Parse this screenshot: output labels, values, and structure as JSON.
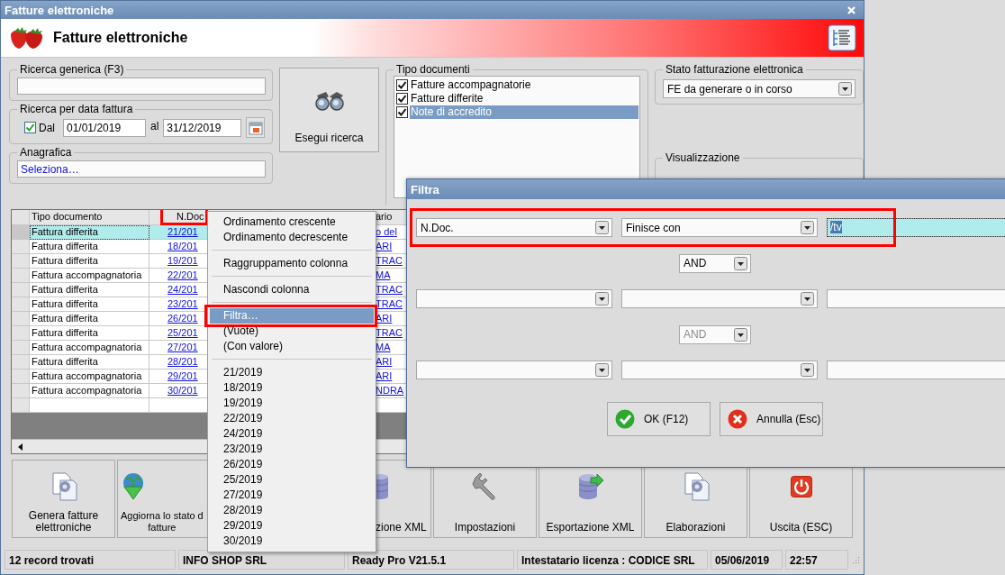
{
  "window": {
    "title": "Fatture elettroniche"
  },
  "header": {
    "title": "Fatture elettroniche"
  },
  "search_generic": {
    "label": "Ricerca generica (F3)"
  },
  "date_search": {
    "label": "Ricerca per data fattura",
    "checkbox": {
      "label": "Dal",
      "checked": true
    },
    "from": "01/01/2019",
    "to_label": "al",
    "to": "31/12/2019"
  },
  "anagrafica": {
    "label": "Anagrafica",
    "value": "Seleziona…"
  },
  "search_button": {
    "label": "Esegui ricerca"
  },
  "document_types": {
    "label": "Tipo documenti",
    "items": [
      {
        "label": "Fatture accompagnatorie",
        "checked": true,
        "selected": false
      },
      {
        "label": "Fatture differite",
        "checked": true,
        "selected": false
      },
      {
        "label": "Note di accredito",
        "checked": true,
        "selected": true
      }
    ]
  },
  "fe_status": {
    "label": "Stato fatturazione elettronica",
    "value": "FE da generare o in corso"
  },
  "view": {
    "label": "Visualizzazione"
  },
  "table": {
    "columns": [
      {
        "label": "Tipo documento",
        "highlight": false
      },
      {
        "label": "N.Doc",
        "highlight": true
      },
      {
        "label": "ario",
        "highlight": false
      }
    ],
    "rows": [
      {
        "cells": [
          "Fattura differita",
          "21/201",
          "o del"
        ],
        "selected": true
      },
      {
        "cells": [
          "Fattura differita",
          "18/201",
          "ARI"
        ],
        "selected": false
      },
      {
        "cells": [
          "Fattura differita",
          "19/201",
          "TRAC"
        ],
        "selected": false
      },
      {
        "cells": [
          "Fattura accompagnatoria",
          "22/201",
          "MA"
        ],
        "selected": false
      },
      {
        "cells": [
          "Fattura differita",
          "24/201",
          "TRAC"
        ],
        "selected": false
      },
      {
        "cells": [
          "Fattura differita",
          "23/201",
          "TRAC"
        ],
        "selected": false
      },
      {
        "cells": [
          "Fattura differita",
          "26/201",
          "ARI"
        ],
        "selected": false
      },
      {
        "cells": [
          "Fattura differita",
          "25/201",
          "TRAC"
        ],
        "selected": false
      },
      {
        "cells": [
          "Fattura accompagnatoria",
          "27/201",
          "MA"
        ],
        "selected": false
      },
      {
        "cells": [
          "Fattura differita",
          "28/201",
          "ARI"
        ],
        "selected": false
      },
      {
        "cells": [
          "Fattura accompagnatoria",
          "29/201",
          "ARI"
        ],
        "selected": false
      },
      {
        "cells": [
          "Fattura accompagnatoria",
          "30/201",
          "NDRA"
        ],
        "selected": false
      }
    ]
  },
  "toolbar": {
    "buttons": [
      {
        "lines": [
          "Genera fatture",
          "elettroniche"
        ],
        "kind": "whole"
      },
      {
        "lines": [
          "Aggiorna lo stato d",
          "fatture"
        ],
        "kind": "cutright"
      },
      {
        "lines": [
          "zione XML"
        ],
        "kind": "cutleft"
      },
      {
        "lines": [
          "Impostazioni"
        ],
        "kind": "whole"
      },
      {
        "lines": [
          "Esportazione XML"
        ],
        "kind": "whole"
      },
      {
        "lines": [
          "Elaborazioni"
        ],
        "kind": "whole"
      },
      {
        "lines": [
          "Uscita (ESC)"
        ],
        "kind": "whole"
      }
    ]
  },
  "status_bar": [
    "12 record trovati",
    "INFO SHOP SRL",
    "Ready Pro V21.5.1",
    "Intestatario licenza : CODICE SRL",
    "05/06/2019",
    "22:57"
  ],
  "context_menu": {
    "items": [
      {
        "kind": "item",
        "label": "Ordinamento crescente",
        "selected": false,
        "highlight": false
      },
      {
        "kind": "item",
        "label": "Ordinamento decrescente",
        "selected": false,
        "highlight": false
      },
      {
        "kind": "separator"
      },
      {
        "kind": "item",
        "label": "Raggruppamento colonna",
        "selected": false,
        "highlight": false
      },
      {
        "kind": "separator"
      },
      {
        "kind": "item",
        "label": "Nascondi colonna",
        "selected": false,
        "highlight": false
      },
      {
        "kind": "separator"
      },
      {
        "kind": "item",
        "label": "Filtra…",
        "selected": true,
        "highlight": true
      },
      {
        "kind": "item",
        "label": "(Vuote)",
        "selected": false,
        "highlight": false
      },
      {
        "kind": "item",
        "label": "(Con valore)",
        "selected": false,
        "highlight": false
      },
      {
        "kind": "separator"
      },
      {
        "kind": "item",
        "label": "21/2019",
        "selected": false,
        "highlight": false
      },
      {
        "kind": "item",
        "label": "18/2019",
        "selected": false,
        "highlight": false
      },
      {
        "kind": "item",
        "label": "19/2019",
        "selected": false,
        "highlight": false
      },
      {
        "kind": "item",
        "label": "22/2019",
        "selected": false,
        "highlight": false
      },
      {
        "kind": "item",
        "label": "24/2019",
        "selected": false,
        "highlight": false
      },
      {
        "kind": "item",
        "label": "23/2019",
        "selected": false,
        "highlight": false
      },
      {
        "kind": "item",
        "label": "26/2019",
        "selected": false,
        "highlight": false
      },
      {
        "kind": "item",
        "label": "25/2019",
        "selected": false,
        "highlight": false
      },
      {
        "kind": "item",
        "label": "27/2019",
        "selected": false,
        "highlight": false
      },
      {
        "kind": "item",
        "label": "28/2019",
        "selected": false,
        "highlight": false
      },
      {
        "kind": "item",
        "label": "29/2019",
        "selected": false,
        "highlight": false
      },
      {
        "kind": "item",
        "label": "30/2019",
        "selected": false,
        "highlight": false
      }
    ]
  },
  "filter_dialog": {
    "title": "Filtra",
    "conditions": [
      {
        "field": "N.Doc.",
        "operator": "Finisce con",
        "value": "/tv",
        "focused": true,
        "text_selected": true,
        "highlight": true
      },
      {
        "focused": false
      },
      {
        "focused": false
      }
    ],
    "connectors": [
      {
        "label": "AND",
        "disabled": false
      },
      {
        "label": "AND",
        "disabled": true
      }
    ],
    "buttons": [
      {
        "label": "OK (F12)",
        "kind": "ok"
      },
      {
        "label": "Annulla (Esc)",
        "kind": "cancel"
      }
    ]
  }
}
